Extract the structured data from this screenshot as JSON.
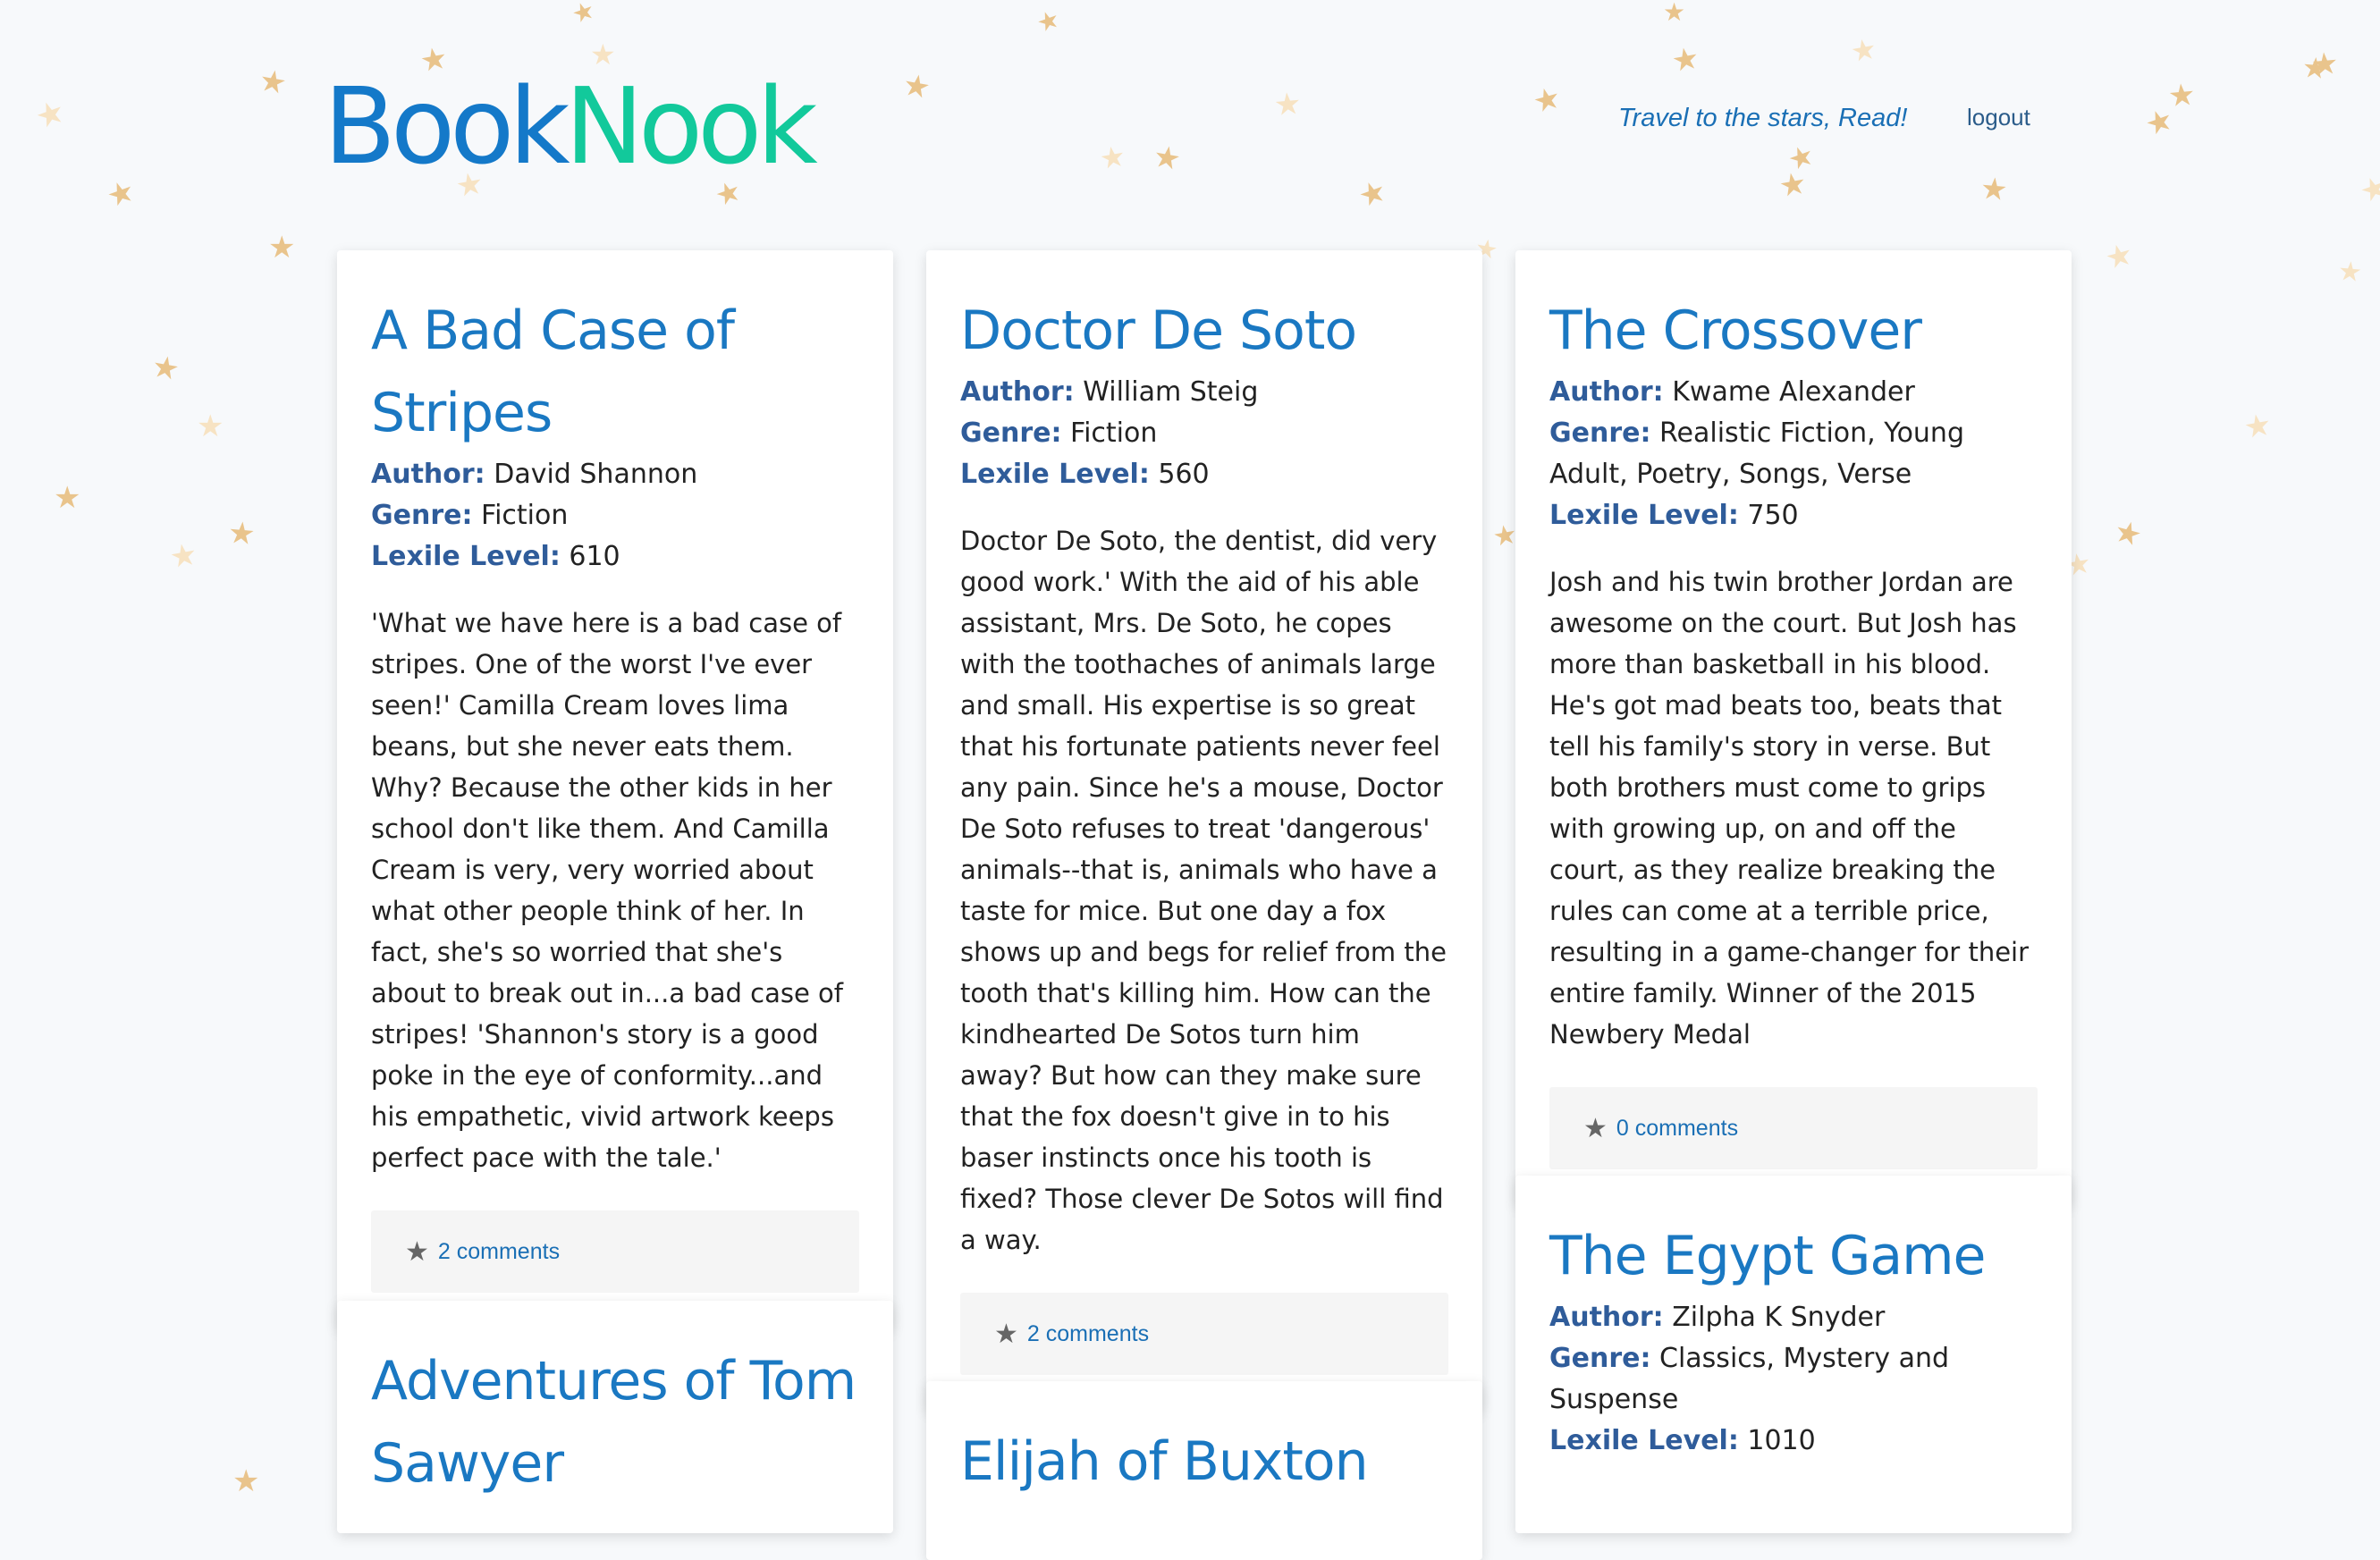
{
  "header": {
    "logo_part1": "Book",
    "logo_part2": "Nook",
    "tagline": "Travel to the stars, Read!",
    "logout_label": "logout"
  },
  "labels": {
    "author": "Author:",
    "genre": "Genre:",
    "lexile": "Lexile Level:"
  },
  "decor": {
    "icon": "star-icon",
    "star_color": "#e9c48c"
  },
  "books": [
    {
      "title": "A Bad Case of Stripes",
      "author": "David Shannon",
      "genre": "Fiction",
      "lexile": "610",
      "description": "'What we have here is a bad case of stripes. One of the worst I've ever seen!' Camilla Cream loves lima beans, but she never eats them. Why? Because the other kids in her school don't like them. And Camilla Cream is very, very worried about what other people think of her. In fact, she's so worried that she's about to break out in...a bad case of stripes! 'Shannon's story is a good poke in the eye of conformity...and his empathetic, vivid artwork keeps perfect pace with the tale.'",
      "comments": "2 comments"
    },
    {
      "title": "Doctor De Soto",
      "author": "William Steig",
      "genre": "Fiction",
      "lexile": "560",
      "description": "Doctor De Soto, the dentist, did very good work.' With the aid of his able assistant, Mrs. De Soto, he copes with the toothaches of animals large and small. His expertise is so great that his fortunate patients never feel any pain. Since he's a mouse, Doctor De Soto refuses to treat 'dangerous' animals--that is, animals who have a taste for mice. But one day a fox shows up and begs for relief from the tooth that's killing him. How can the kindhearted De Sotos turn him away? But how can they make sure that the fox doesn't give in to his baser instincts once his tooth is fixed? Those clever De Sotos will find a way.",
      "comments": "2 comments"
    },
    {
      "title": "The Crossover",
      "author": "Kwame Alexander",
      "genre": "Realistic Fiction, Young Adult, Poetry, Songs, Verse",
      "lexile": "750",
      "description": "Josh and his twin brother Jordan are awesome on the court. But Josh has more than basketball in his blood. He's got mad beats too, beats that tell his family's story in verse. But both brothers must come to grips with growing up, on and off the court, as they realize breaking the rules can come at a terrible price, resulting in a game-changer for their entire family. Winner of the 2015 Newbery Medal",
      "comments": "0 comments"
    },
    {
      "title": "Adventures of Tom Sawyer"
    },
    {
      "title": "Elijah of Buxton"
    },
    {
      "title": "The Egypt Game",
      "author": "Zilpha K Snyder",
      "genre": "Classics, Mystery and Suspense",
      "lexile": "1010"
    }
  ]
}
